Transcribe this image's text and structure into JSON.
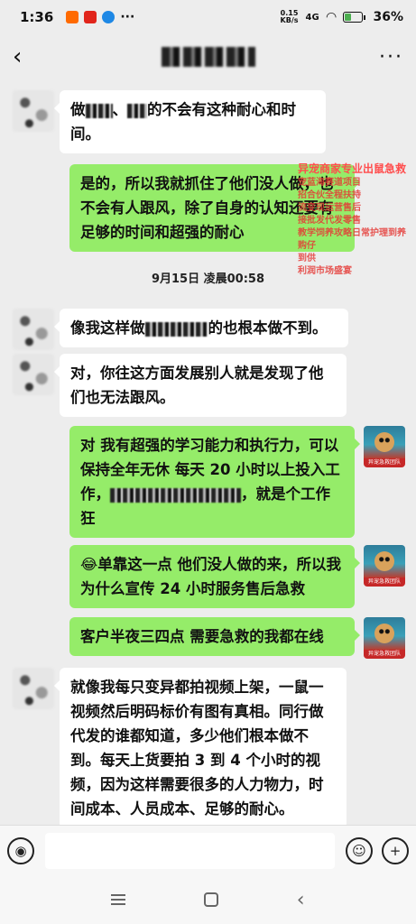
{
  "status_bar": {
    "time": "1:36",
    "network_speed": "0.15",
    "network_unit": "KB/s",
    "signal": "4G",
    "battery_pct": "36%",
    "battery_level": 0.36,
    "icons": [
      "taobao-app-icon",
      "jd-app-icon",
      "browser-app-icon",
      "more-dots-icon",
      "wifi-icon",
      "battery-icon"
    ]
  },
  "header": {
    "back_icon": "‹",
    "more_icon": "···"
  },
  "messages": [
    {
      "side": "left",
      "parts": [
        "做",
        "[blur]",
        "、",
        "[blur]",
        "的不会有这种耐心和时间。"
      ]
    },
    {
      "side": "right",
      "text": "是的，所以我就抓住了他们没人做，也不会有人跟风，除了自身的认知还要有足够的时间和超强的耐心"
    },
    {
      "side": "left",
      "parts": [
        "像我这样做",
        "[blur]",
        "的也根本做不到。"
      ]
    },
    {
      "side": "left",
      "text": "对，你往这方面发展别人就是发现了他们也无法跟风。"
    },
    {
      "side": "right",
      "parts": [
        "对 我有超强的学习能力和执行力，可以保持全年无休 每天 20 小时以上投入工作，",
        "[blur]",
        "，就是个工作狂"
      ]
    },
    {
      "side": "right",
      "text": "😂单靠这一点 他们没人做的来，所以我为什么宣传 24 小时服务售后急救"
    },
    {
      "side": "right",
      "text": "客户半夜三四点 需要急救的我都在线"
    },
    {
      "side": "left",
      "text": "就像我每只变异都拍视频上架，一鼠一视频然后明码标价有图有真相。同行做代发的谁都知道，多少他们根本做不到。每天上货要拍 3 到 4 个小时的视频，因为这样需要很多的人力物力，时间成本、人员成本、足够的耐心。"
    }
  ],
  "time_separator": "9月15日 凌晨00:58",
  "overlay_ad": {
    "head": "异宠商家专业出鼠急救",
    "lines": [
      "宠蓝海赛道项目",
      "招合伙全程扶持",
      "流变现运营售后",
      "接批发代发零售",
      "教学饲养攻略日常护理到养",
      "购仔",
      "到供",
      "利润市场盛宴"
    ],
    "badge": "异宠急救团队"
  },
  "avatar_badge": "异宠急救团队",
  "input_bar": {
    "voice_icon": "voice-icon",
    "emoji_icon": "emoji-icon",
    "plus_icon": "plus-icon"
  }
}
